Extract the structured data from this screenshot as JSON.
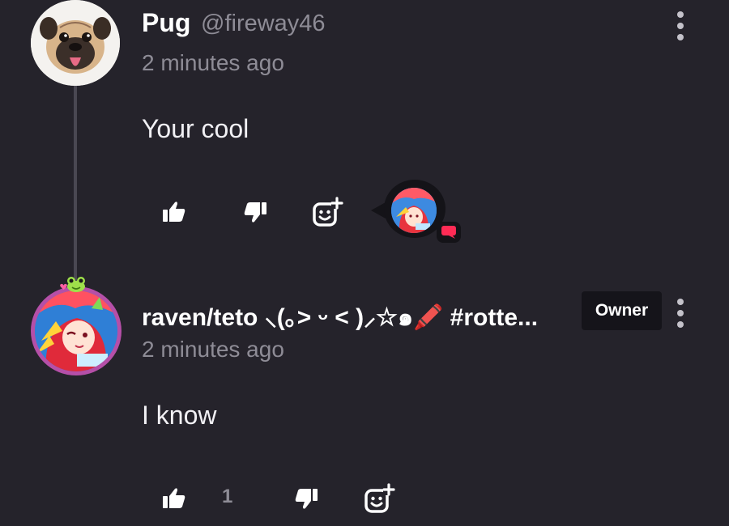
{
  "comments": [
    {
      "username": "Pug",
      "handle": "@fireway46",
      "timestamp": "2 minutes ago",
      "text": "Your cool",
      "avatar_icon": "pug-photo",
      "reply_avatar_icon": "anime-avatar"
    },
    {
      "username": "raven/teto ⸜(｡˃ ᵕ ˂ )⸝☆๑🖍️ #rotte...",
      "timestamp": "2 minutes ago",
      "text": "I know",
      "badge": "Owner",
      "like_count": "1",
      "avatar_icon": "anime-avatar"
    }
  ],
  "colors": {
    "background": "#25232b",
    "text_primary": "#ffffff",
    "text_secondary": "#8e8c96",
    "accent_red": "#ff2b55",
    "avatar_ring": "#b54fa8"
  }
}
